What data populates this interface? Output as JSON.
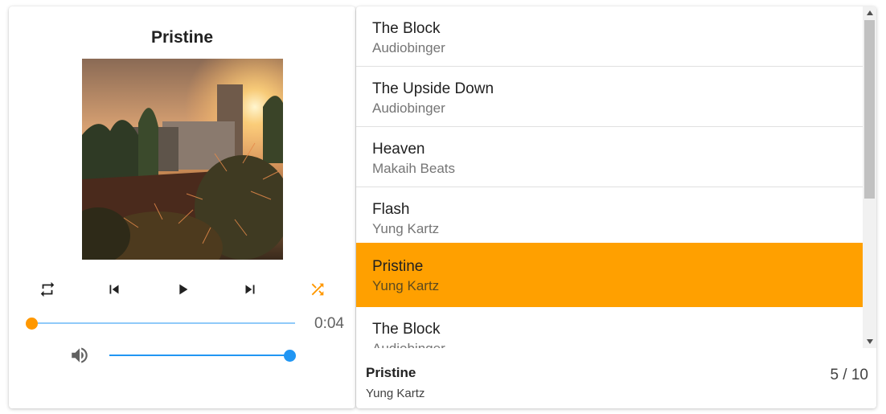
{
  "player": {
    "title": "Pristine",
    "cover_icon": "album-cover-image",
    "controls": {
      "repeat_icon": "repeat-icon",
      "previous_icon": "skip-previous-icon",
      "play_icon": "play-icon",
      "next_icon": "skip-next-icon",
      "shuffle_icon": "shuffle-icon",
      "shuffle_color": "#ff9800"
    },
    "progress": {
      "value": 0,
      "time": "0:04",
      "thumb_color": "#ff9800",
      "track_color": "#90caf9"
    },
    "volume": {
      "icon": "volume-up-icon",
      "value": 1.0,
      "color": "#2196f3"
    }
  },
  "playlist": {
    "items": [
      {
        "title": "The Block",
        "artist": "Audiobinger"
      },
      {
        "title": "The Upside Down",
        "artist": "Audiobinger"
      },
      {
        "title": "Heaven",
        "artist": "Makaih Beats"
      },
      {
        "title": "Flash",
        "artist": "Yung Kartz"
      },
      {
        "title": "Pristine",
        "artist": "Yung Kartz",
        "active": true
      },
      {
        "title": "The Block",
        "artist": "Audiobinger"
      }
    ],
    "active_color": "#ffa000"
  },
  "footer": {
    "title": "Pristine",
    "artist": "Yung Kartz",
    "count": "5 / 10"
  }
}
